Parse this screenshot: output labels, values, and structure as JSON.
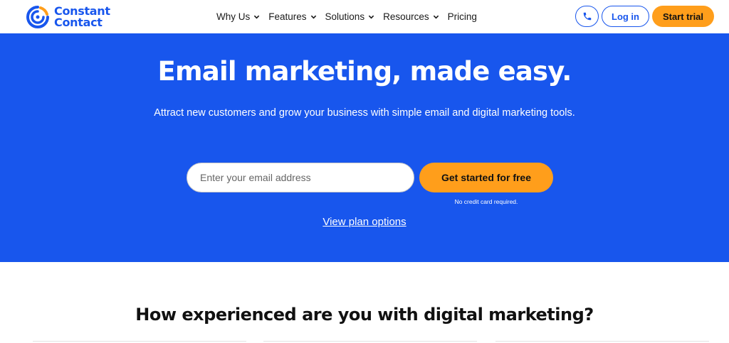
{
  "header": {
    "logo": {
      "line1": "Constant",
      "line2": "Contact"
    },
    "nav": [
      {
        "label": "Why Us",
        "has_dropdown": true
      },
      {
        "label": "Features",
        "has_dropdown": true
      },
      {
        "label": "Solutions",
        "has_dropdown": true
      },
      {
        "label": "Resources",
        "has_dropdown": true
      },
      {
        "label": "Pricing",
        "has_dropdown": false
      }
    ],
    "phone_icon": "phone-icon",
    "login_label": "Log in",
    "trial_label": "Start trial"
  },
  "hero": {
    "title": "Email marketing, made easy.",
    "subtitle": "Attract new customers and grow your business with simple email and digital marketing tools.",
    "email_placeholder": "Enter your email address",
    "cta_label": "Get started for free",
    "cta_note": "No credit card required.",
    "plan_link": "View plan options"
  },
  "section": {
    "title": "How experienced are you with digital marketing?"
  },
  "colors": {
    "brand_blue": "#1856ed",
    "accent_orange": "#ff9e1b",
    "white": "#ffffff"
  }
}
